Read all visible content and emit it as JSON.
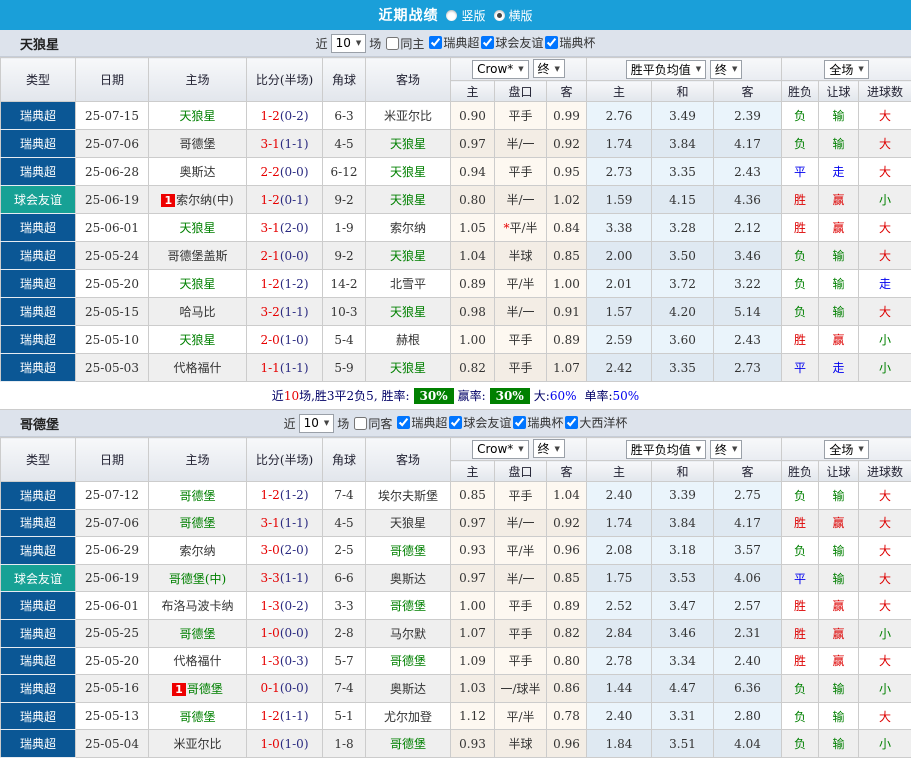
{
  "topbar": {
    "title": "近期战绩",
    "radios": [
      {
        "label": "竖版",
        "checked": false
      },
      {
        "label": "横版",
        "checked": true
      }
    ]
  },
  "colors": {
    "topbar_blue": "#1a9fd9",
    "league_navy": "#0b5795",
    "friendly_teal": "#17a195",
    "win_red": "#dd0000",
    "draw_blue": "#0000ee",
    "lose_green": "#008000",
    "score_red": "#e60000",
    "badge_green": "#008000"
  },
  "filter_labels": {
    "near": "近",
    "count": "10",
    "games": "场"
  },
  "table_header": {
    "type": "类型",
    "date": "日期",
    "home": "主场",
    "score": "比分(半场)",
    "corner": "角球",
    "away": "客场",
    "odds_source": "Crow*",
    "odds_final": "终",
    "mean": "胜平负均值",
    "mean_final": "终",
    "fulltime": "全场",
    "odds_home": "主",
    "handicap": "盘口",
    "odds_away": "客",
    "mean_home": "主",
    "mean_draw": "和",
    "mean_away": "客",
    "result": "胜负",
    "let_ball": "让球",
    "goals": "进球数"
  },
  "sections": [
    {
      "team": "天狼星",
      "same_venue": {
        "label": "同主",
        "checked": false
      },
      "leagues": [
        {
          "label": "瑞典超",
          "checked": true
        },
        {
          "label": "球会友谊",
          "checked": true
        },
        {
          "label": "瑞典杯",
          "checked": true
        }
      ],
      "rows": [
        {
          "league": "瑞典超",
          "friendly": false,
          "date": "25-07-15",
          "home": "天狼星",
          "home_self": true,
          "home_badge": false,
          "score": "1-2",
          "half": "(0-2)",
          "corner": "6-3",
          "away": "米亚尔比",
          "away_self": false,
          "away_badge": false,
          "odds": [
            "0.90",
            "平手",
            "0.99"
          ],
          "star": false,
          "mean": [
            "2.76",
            "3.49",
            "2.39"
          ],
          "outcome": [
            "负",
            "输",
            "大"
          ]
        },
        {
          "league": "瑞典超",
          "friendly": false,
          "date": "25-07-06",
          "home": "哥德堡",
          "home_self": false,
          "home_badge": false,
          "score": "3-1",
          "half": "(1-1)",
          "corner": "4-5",
          "away": "天狼星",
          "away_self": true,
          "away_badge": false,
          "odds": [
            "0.97",
            "半/一",
            "0.92"
          ],
          "star": false,
          "mean": [
            "1.74",
            "3.84",
            "4.17"
          ],
          "outcome": [
            "负",
            "输",
            "大"
          ]
        },
        {
          "league": "瑞典超",
          "friendly": false,
          "date": "25-06-28",
          "home": "奥斯达",
          "home_self": false,
          "home_badge": false,
          "score": "2-2",
          "half": "(0-0)",
          "corner": "6-12",
          "away": "天狼星",
          "away_self": true,
          "away_badge": false,
          "odds": [
            "0.94",
            "平手",
            "0.95"
          ],
          "star": false,
          "mean": [
            "2.73",
            "3.35",
            "2.43"
          ],
          "outcome": [
            "平",
            "走",
            "大"
          ]
        },
        {
          "league": "球会友谊",
          "friendly": true,
          "date": "25-06-19",
          "home": "索尔纳(中)",
          "home_self": false,
          "home_badge": true,
          "score": "1-2",
          "half": "(0-1)",
          "corner": "9-2",
          "away": "天狼星",
          "away_self": true,
          "away_badge": false,
          "odds": [
            "0.80",
            "半/一",
            "1.02"
          ],
          "star": false,
          "mean": [
            "1.59",
            "4.15",
            "4.36"
          ],
          "outcome": [
            "胜",
            "赢",
            "小"
          ]
        },
        {
          "league": "瑞典超",
          "friendly": false,
          "date": "25-06-01",
          "home": "天狼星",
          "home_self": true,
          "home_badge": false,
          "score": "3-1",
          "half": "(2-0)",
          "corner": "1-9",
          "away": "索尔纳",
          "away_self": false,
          "away_badge": false,
          "odds": [
            "1.05",
            "平/半",
            "0.84"
          ],
          "star": true,
          "mean": [
            "3.38",
            "3.28",
            "2.12"
          ],
          "outcome": [
            "胜",
            "赢",
            "大"
          ]
        },
        {
          "league": "瑞典超",
          "friendly": false,
          "date": "25-05-24",
          "home": "哥德堡盖斯",
          "home_self": false,
          "home_badge": false,
          "score": "2-1",
          "half": "(0-0)",
          "corner": "9-2",
          "away": "天狼星",
          "away_self": true,
          "away_badge": false,
          "odds": [
            "1.04",
            "半球",
            "0.85"
          ],
          "star": false,
          "mean": [
            "2.00",
            "3.50",
            "3.46"
          ],
          "outcome": [
            "负",
            "输",
            "大"
          ]
        },
        {
          "league": "瑞典超",
          "friendly": false,
          "date": "25-05-20",
          "home": "天狼星",
          "home_self": true,
          "home_badge": false,
          "score": "1-2",
          "half": "(1-2)",
          "corner": "14-2",
          "away": "北雪平",
          "away_self": false,
          "away_badge": false,
          "odds": [
            "0.89",
            "平/半",
            "1.00"
          ],
          "star": false,
          "mean": [
            "2.01",
            "3.72",
            "3.22"
          ],
          "outcome": [
            "负",
            "输",
            "走"
          ]
        },
        {
          "league": "瑞典超",
          "friendly": false,
          "date": "25-05-15",
          "home": "哈马比",
          "home_self": false,
          "home_badge": false,
          "score": "3-2",
          "half": "(1-1)",
          "corner": "10-3",
          "away": "天狼星",
          "away_self": true,
          "away_badge": false,
          "odds": [
            "0.98",
            "半/一",
            "0.91"
          ],
          "star": false,
          "mean": [
            "1.57",
            "4.20",
            "5.14"
          ],
          "outcome": [
            "负",
            "输",
            "大"
          ]
        },
        {
          "league": "瑞典超",
          "friendly": false,
          "date": "25-05-10",
          "home": "天狼星",
          "home_self": true,
          "home_badge": false,
          "score": "2-0",
          "half": "(1-0)",
          "corner": "5-4",
          "away": "赫根",
          "away_self": false,
          "away_badge": false,
          "odds": [
            "1.00",
            "平手",
            "0.89"
          ],
          "star": false,
          "mean": [
            "2.59",
            "3.60",
            "2.43"
          ],
          "outcome": [
            "胜",
            "赢",
            "小"
          ]
        },
        {
          "league": "瑞典超",
          "friendly": false,
          "date": "25-05-03",
          "home": "代格福什",
          "home_self": false,
          "home_badge": false,
          "score": "1-1",
          "half": "(1-1)",
          "corner": "5-9",
          "away": "天狼星",
          "away_self": true,
          "away_badge": false,
          "odds": [
            "0.82",
            "平手",
            "1.07"
          ],
          "star": false,
          "mean": [
            "2.42",
            "3.35",
            "2.73"
          ],
          "outcome": [
            "平",
            "走",
            "小"
          ]
        }
      ],
      "summary": {
        "p1": "近",
        "count": "10",
        "p2": "场,胜3平2负5, 胜率:",
        "rate1": "30%",
        "label2": "赢率:",
        "rate2": "30%",
        "label3": "大:",
        "val3": "60%",
        "label4": "单率:",
        "val4": "50%"
      }
    },
    {
      "team": "哥德堡",
      "same_venue": {
        "label": "同客",
        "checked": false
      },
      "leagues": [
        {
          "label": "瑞典超",
          "checked": true
        },
        {
          "label": "球会友谊",
          "checked": true
        },
        {
          "label": "瑞典杯",
          "checked": true
        },
        {
          "label": "大西洋杯",
          "checked": true
        }
      ],
      "rows": [
        {
          "league": "瑞典超",
          "friendly": false,
          "date": "25-07-12",
          "home": "哥德堡",
          "home_self": true,
          "home_badge": false,
          "score": "1-2",
          "half": "(1-2)",
          "corner": "7-4",
          "away": "埃尔夫斯堡",
          "away_self": false,
          "away_badge": false,
          "odds": [
            "0.85",
            "平手",
            "1.04"
          ],
          "star": false,
          "mean": [
            "2.40",
            "3.39",
            "2.75"
          ],
          "outcome": [
            "负",
            "输",
            "大"
          ]
        },
        {
          "league": "瑞典超",
          "friendly": false,
          "date": "25-07-06",
          "home": "哥德堡",
          "home_self": true,
          "home_badge": false,
          "score": "3-1",
          "half": "(1-1)",
          "corner": "4-5",
          "away": "天狼星",
          "away_self": false,
          "away_badge": false,
          "odds": [
            "0.97",
            "半/一",
            "0.92"
          ],
          "star": false,
          "mean": [
            "1.74",
            "3.84",
            "4.17"
          ],
          "outcome": [
            "胜",
            "赢",
            "大"
          ]
        },
        {
          "league": "瑞典超",
          "friendly": false,
          "date": "25-06-29",
          "home": "索尔纳",
          "home_self": false,
          "home_badge": false,
          "score": "3-0",
          "half": "(2-0)",
          "corner": "2-5",
          "away": "哥德堡",
          "away_self": true,
          "away_badge": false,
          "odds": [
            "0.93",
            "平/半",
            "0.96"
          ],
          "star": false,
          "mean": [
            "2.08",
            "3.18",
            "3.57"
          ],
          "outcome": [
            "负",
            "输",
            "大"
          ]
        },
        {
          "league": "球会友谊",
          "friendly": true,
          "date": "25-06-19",
          "home": "哥德堡(中)",
          "home_self": true,
          "home_badge": false,
          "score": "3-3",
          "half": "(1-1)",
          "corner": "6-6",
          "away": "奥斯达",
          "away_self": false,
          "away_badge": false,
          "odds": [
            "0.97",
            "半/一",
            "0.85"
          ],
          "star": false,
          "mean": [
            "1.75",
            "3.53",
            "4.06"
          ],
          "outcome": [
            "平",
            "输",
            "大"
          ]
        },
        {
          "league": "瑞典超",
          "friendly": false,
          "date": "25-06-01",
          "home": "布洛马波卡纳",
          "home_self": false,
          "home_badge": false,
          "score": "1-3",
          "half": "(0-2)",
          "corner": "3-3",
          "away": "哥德堡",
          "away_self": true,
          "away_badge": false,
          "odds": [
            "1.00",
            "平手",
            "0.89"
          ],
          "star": false,
          "mean": [
            "2.52",
            "3.47",
            "2.57"
          ],
          "outcome": [
            "胜",
            "赢",
            "大"
          ]
        },
        {
          "league": "瑞典超",
          "friendly": false,
          "date": "25-05-25",
          "home": "哥德堡",
          "home_self": true,
          "home_badge": false,
          "score": "1-0",
          "half": "(0-0)",
          "corner": "2-8",
          "away": "马尔默",
          "away_self": false,
          "away_badge": false,
          "odds": [
            "1.07",
            "平手",
            "0.82"
          ],
          "star": false,
          "mean": [
            "2.84",
            "3.46",
            "2.31"
          ],
          "outcome": [
            "胜",
            "赢",
            "小"
          ]
        },
        {
          "league": "瑞典超",
          "friendly": false,
          "date": "25-05-20",
          "home": "代格福什",
          "home_self": false,
          "home_badge": false,
          "score": "1-3",
          "half": "(0-3)",
          "corner": "5-7",
          "away": "哥德堡",
          "away_self": true,
          "away_badge": false,
          "odds": [
            "1.09",
            "平手",
            "0.80"
          ],
          "star": false,
          "mean": [
            "2.78",
            "3.34",
            "2.40"
          ],
          "outcome": [
            "胜",
            "赢",
            "大"
          ]
        },
        {
          "league": "瑞典超",
          "friendly": false,
          "date": "25-05-16",
          "home": "哥德堡",
          "home_self": true,
          "home_badge": true,
          "score": "0-1",
          "half": "(0-0)",
          "corner": "7-4",
          "away": "奥斯达",
          "away_self": false,
          "away_badge": false,
          "odds": [
            "1.03",
            "一/球半",
            "0.86"
          ],
          "star": false,
          "mean": [
            "1.44",
            "4.47",
            "6.36"
          ],
          "outcome": [
            "负",
            "输",
            "小"
          ]
        },
        {
          "league": "瑞典超",
          "friendly": false,
          "date": "25-05-13",
          "home": "哥德堡",
          "home_self": true,
          "home_badge": false,
          "score": "1-2",
          "half": "(1-1)",
          "corner": "5-1",
          "away": "尤尔加登",
          "away_self": false,
          "away_badge": false,
          "odds": [
            "1.12",
            "平/半",
            "0.78"
          ],
          "star": false,
          "mean": [
            "2.40",
            "3.31",
            "2.80"
          ],
          "outcome": [
            "负",
            "输",
            "大"
          ]
        },
        {
          "league": "瑞典超",
          "friendly": false,
          "date": "25-05-04",
          "home": "米亚尔比",
          "home_self": false,
          "home_badge": false,
          "score": "1-0",
          "half": "(1-0)",
          "corner": "1-8",
          "away": "哥德堡",
          "away_self": true,
          "away_badge": false,
          "odds": [
            "0.93",
            "半球",
            "0.96"
          ],
          "star": false,
          "mean": [
            "1.84",
            "3.51",
            "4.04"
          ],
          "outcome": [
            "负",
            "输",
            "小"
          ]
        }
      ]
    }
  ]
}
